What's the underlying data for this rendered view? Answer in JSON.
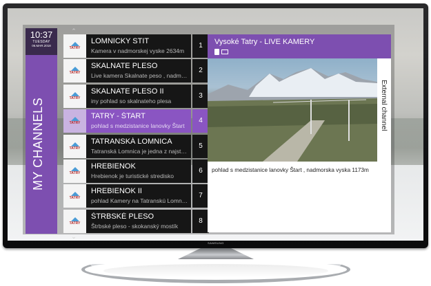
{
  "tv": {
    "brand": "SAMSUNG"
  },
  "clock": {
    "time": "10:37",
    "day": "TUESDAY",
    "date": "06.MAR.2018"
  },
  "sidebar": {
    "title": "MY CHANNELS"
  },
  "channel_logo_text": "TATRY",
  "channels": [
    {
      "name": "LOMNICKY STIT",
      "desc": "Kamera v nadmorskej vyske 2634m",
      "num": "1"
    },
    {
      "name": "SKALNATE PLESO",
      "desc": "Live kamera Skalnate peso , nadmorska",
      "num": "2"
    },
    {
      "name": "SKALNATE PLESO II",
      "desc": "iny pohlad so skalnateho plesa",
      "num": "3"
    },
    {
      "name": "TATRY - ŠTART",
      "desc": "pohlad s medzistanice lanovky Štart",
      "num": "4"
    },
    {
      "name": "TATRANSKÁ LOMNICA",
      "desc": "Tatranská Lomnica je jedna z najstarších",
      "num": "5"
    },
    {
      "name": "HREBIENOK",
      "desc": "Hrebienok je turistické stredisko",
      "num": "6"
    },
    {
      "name": "HREBIENOK II",
      "desc": "pohlad Kamery na Tatranskú Lomnicu",
      "num": "7"
    },
    {
      "name": "ŠTRBSKÉ PLESO",
      "desc": "Štrbské pleso - skokanský mostík",
      "num": "8"
    }
  ],
  "detail": {
    "title": "Vysoké Tatry - LIVE KAMERY",
    "side_label": "External channel",
    "caption": "pohlad s medzistanice lanovky Štart , nadmorska vyska 1173m"
  },
  "colors": {
    "accent": "#7d4fb0",
    "active_row": "#8a55c2",
    "clock_bg": "#3a2a4d"
  },
  "icons": [
    "chevron-up-icon",
    "chevron-down-icon",
    "mobile-icon",
    "tv-icon",
    "mountain-logo-icon"
  ]
}
